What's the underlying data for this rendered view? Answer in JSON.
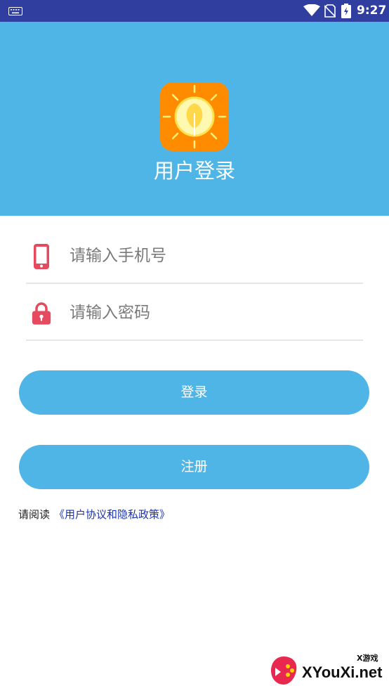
{
  "status_bar": {
    "time": "9:27",
    "icons": [
      "keyboard-icon",
      "wifi-icon",
      "sim-off-icon",
      "battery-charging-icon"
    ]
  },
  "header": {
    "title": "用户登录",
    "logo_icon": "sun-lightbulb-icon",
    "background_color": "#4fb5e6",
    "logo_background_color": "#ff8c00"
  },
  "form": {
    "phone": {
      "placeholder": "请输入手机号",
      "icon": "phone-icon",
      "value": ""
    },
    "password": {
      "placeholder": "请输入密码",
      "icon": "lock-icon",
      "value": ""
    }
  },
  "buttons": {
    "login_label": "登录",
    "register_label": "注册",
    "color": "#4fb5e6"
  },
  "agreement": {
    "prefix": "请阅读",
    "link": "《用户协议和隐私政策》",
    "link_color": "#1a33b3"
  },
  "watermark": {
    "small": "X游戏",
    "text": "XYouXi.net"
  }
}
